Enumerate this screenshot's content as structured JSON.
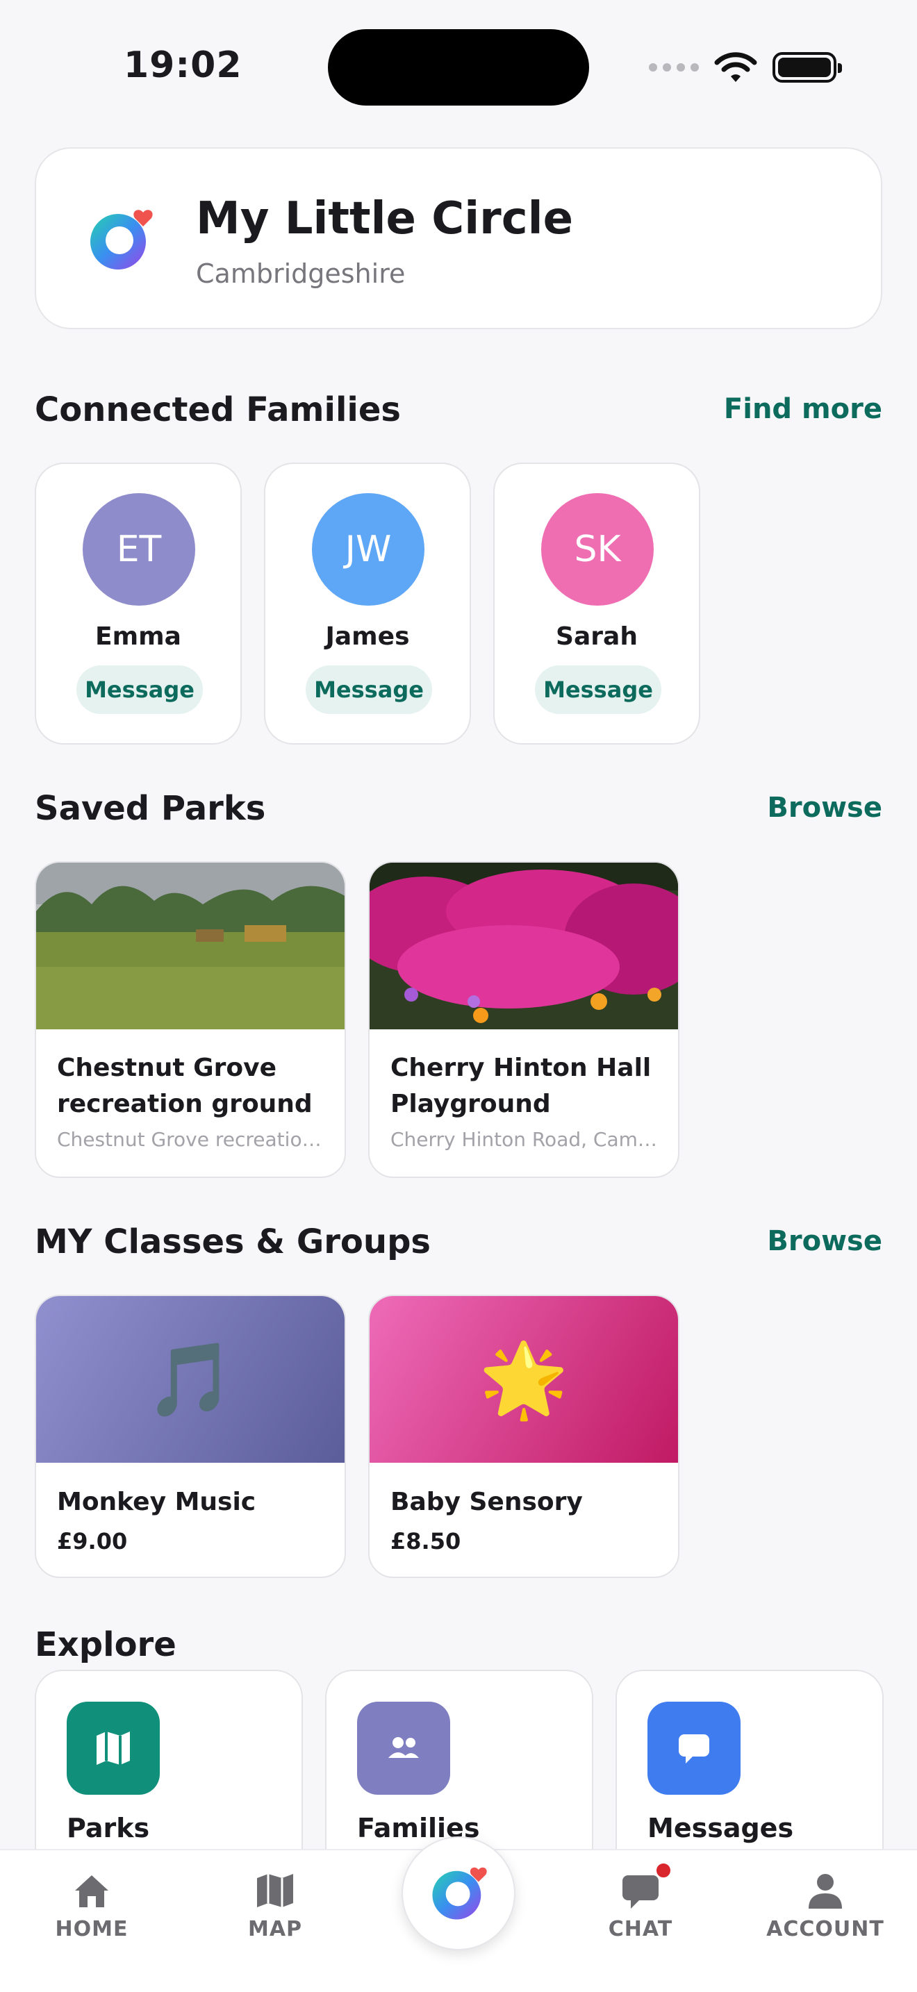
{
  "status_bar": {
    "time": "19:02"
  },
  "header": {
    "title": "My Little Circle",
    "location": "Cambridgeshire"
  },
  "families": {
    "title": "Connected Families",
    "link": "Find more",
    "items": [
      {
        "initials": "ET",
        "name": "Emma",
        "color": "#8f8ccb",
        "action": "Message"
      },
      {
        "initials": "JW",
        "name": "James",
        "color": "#5ea6f6",
        "action": "Message"
      },
      {
        "initials": "SK",
        "name": "Sarah",
        "color": "#ef6eb2",
        "action": "Message"
      }
    ]
  },
  "parks": {
    "title": "Saved Parks",
    "link": "Browse",
    "items": [
      {
        "name": "Chestnut Grove recreation ground",
        "address": "Chestnut Grove recreation ground, Cambridge"
      },
      {
        "name": "Cherry Hinton Hall Playground",
        "address": "Cherry Hinton Road, Cambridge"
      }
    ]
  },
  "classes": {
    "title": "MY Classes & Groups",
    "link": "Browse",
    "items": [
      {
        "name": "Monkey Music",
        "price": "£9.00",
        "emoji": "🎵"
      },
      {
        "name": "Baby Sensory",
        "price": "£8.50",
        "emoji": "🌟"
      }
    ]
  },
  "explore": {
    "title": "Explore",
    "items": [
      {
        "label": "Parks",
        "icon": "map-icon",
        "color": "#10907a"
      },
      {
        "label": "Families",
        "icon": "people-icon",
        "color": "#7f7ec0"
      },
      {
        "label": "Messages",
        "icon": "chat-bubble-icon",
        "color": "#3f7cf0"
      }
    ]
  },
  "nav": {
    "items": [
      {
        "label": "HOME",
        "icon": "home-icon"
      },
      {
        "label": "MAP",
        "icon": "map-icon"
      },
      {
        "label": "CHAT",
        "icon": "chat-icon"
      },
      {
        "label": "ACCOUNT",
        "icon": "account-icon"
      }
    ],
    "accent": "#0c6b5c"
  }
}
